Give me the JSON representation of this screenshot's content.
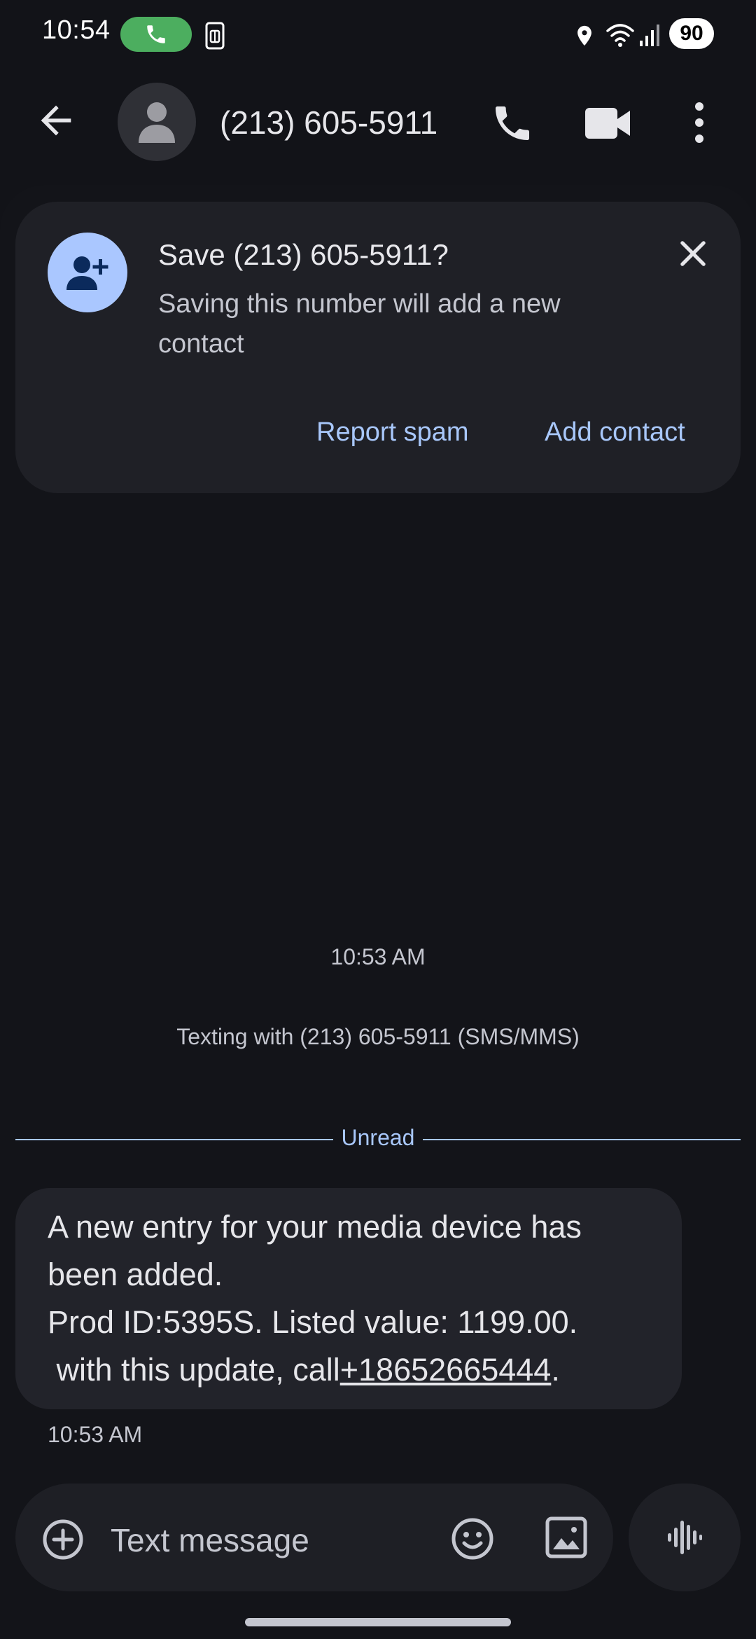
{
  "status_bar": {
    "time": "10:54",
    "battery": "90"
  },
  "header": {
    "title": "(213) 605-5911"
  },
  "save_card": {
    "title": "Save (213) 605-5911?",
    "subtitle": "Saving this number will add a new contact",
    "report_spam": "Report spam",
    "add_contact": "Add contact"
  },
  "conversation": {
    "start_time": "10:53 AM",
    "texting_with": "Texting with (213) 605-5911 (SMS/MMS)",
    "unread_label": "Unread",
    "message": {
      "line1": "A new entry for your media device has",
      "line2": "been added.",
      "line3": "Prod ID:5395S. Listed value: 1199.00.",
      "line4_prefix": " with this update, call",
      "link": "+18652665444",
      "line4_suffix": ".",
      "time": "10:53 AM"
    }
  },
  "compose": {
    "placeholder": "Text message"
  },
  "icons": {
    "call_pill": "phone-icon",
    "sim": "sim-card-icon",
    "location": "location-icon",
    "wifi": "wifi-icon",
    "signal": "signal-icon",
    "back": "arrow-back-icon",
    "avatar": "person-icon",
    "phone": "phone-icon",
    "video": "videocam-icon",
    "more": "more-vert-icon",
    "add_person": "person-add-icon",
    "close": "close-icon",
    "add": "add-circle-icon",
    "emoji": "emoji-icon",
    "gallery": "image-icon",
    "voice": "voice-waveform-icon"
  },
  "colors": {
    "accent": "#a8c7fa",
    "background": "#121318",
    "call_green": "#4cae5f",
    "avatar_blue": "#aac7ff"
  }
}
